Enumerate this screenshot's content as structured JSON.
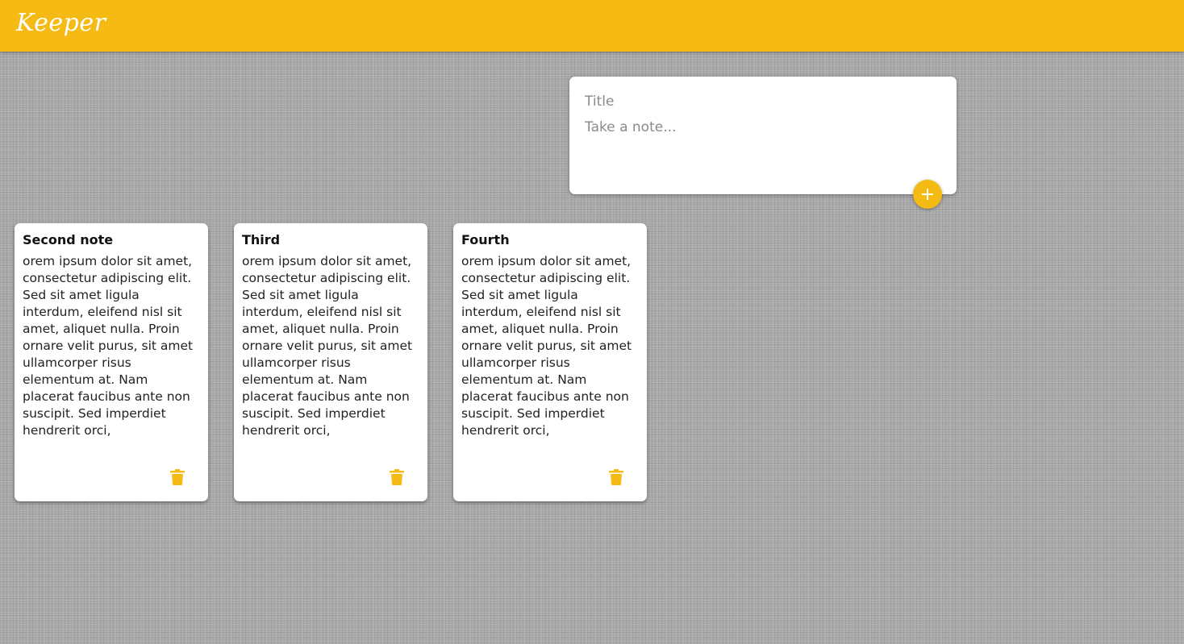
{
  "header": {
    "title": "Keeper"
  },
  "create_area": {
    "title_placeholder": "Title",
    "content_placeholder": "Take a note...",
    "add_icon": "plus-icon"
  },
  "notes": [
    {
      "title": "Second note",
      "content": "orem ipsum dolor sit amet, consectetur adipiscing elit. Sed sit amet ligula interdum, eleifend nisl sit amet, aliquet nulla. Proin ornare velit purus, sit amet ullamcorper risus elementum at. Nam placerat faucibus ante non suscipit. Sed imperdiet hendrerit orci,",
      "delete_icon": "trash-icon"
    },
    {
      "title": "Third",
      "content": "orem ipsum dolor sit amet, consectetur adipiscing elit. Sed sit amet ligula interdum, eleifend nisl sit amet, aliquet nulla. Proin ornare velit purus, sit amet ullamcorper risus elementum at. Nam placerat faucibus ante non suscipit. Sed imperdiet hendrerit orci,",
      "delete_icon": "trash-icon"
    },
    {
      "title": "Fourth",
      "content": "orem ipsum dolor sit amet, consectetur adipiscing elit. Sed sit amet ligula interdum, eleifend nisl sit amet, aliquet nulla. Proin ornare velit purus, sit amet ullamcorper risus elementum at. Nam placerat faucibus ante non suscipit. Sed imperdiet hendrerit orci,",
      "delete_icon": "trash-icon"
    }
  ],
  "colors": {
    "accent": "#f5ba13",
    "card": "#ffffff",
    "background": "#a9a9a9"
  }
}
